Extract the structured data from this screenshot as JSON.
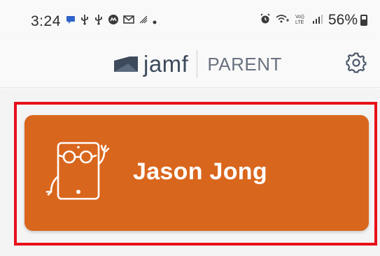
{
  "status_bar": {
    "time": "3:24",
    "battery_text": "56%",
    "left_icons": [
      "message-icon",
      "usb-icon",
      "usb-icon",
      "app-icon",
      "gmail-icon",
      "signal-weak-icon",
      "dot-icon"
    ],
    "right_icons": [
      "alarm-icon",
      "wifi-calling-icon",
      "volte-icon",
      "signal-icon",
      "battery-icon"
    ]
  },
  "header": {
    "brand_name": "jamf",
    "brand_sub": "PARENT",
    "settings_icon": "gear-icon"
  },
  "children": [
    {
      "name": "Jason Jong",
      "avatar_icon": "tablet-character-icon"
    }
  ],
  "colors": {
    "card": "#d9661d",
    "highlight": "#e8101a",
    "brand_text": "#3d4a5c"
  }
}
